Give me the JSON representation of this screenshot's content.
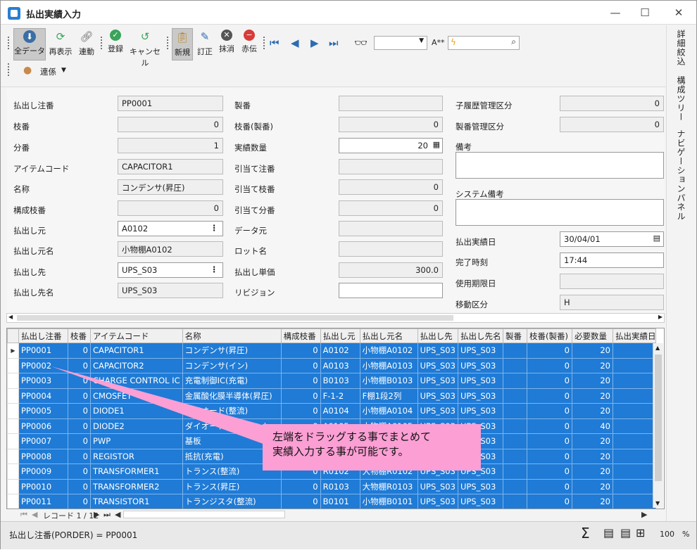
{
  "window": {
    "title": "払出実績入力",
    "minimize": "—",
    "maximize": "☐",
    "close": "✕"
  },
  "toolbar": {
    "buttons": [
      {
        "id": "all-data",
        "label": "全データ",
        "icon": "download-icon"
      },
      {
        "id": "refresh",
        "label": "再表示",
        "icon": "refresh-icon"
      },
      {
        "id": "link",
        "label": "連動",
        "icon": "link-icon"
      },
      {
        "id": "register",
        "label": "登録",
        "icon": "check-icon"
      },
      {
        "id": "cancel",
        "label": "キャンセル",
        "icon": "undo-icon"
      },
      {
        "id": "new",
        "label": "新規",
        "icon": "clipboard-icon"
      },
      {
        "id": "correct",
        "label": "訂正",
        "icon": "pencil-icon"
      },
      {
        "id": "erase",
        "label": "抹消",
        "icon": "x-circle-icon"
      },
      {
        "id": "reverse",
        "label": "赤伝",
        "icon": "minus-circle-icon"
      }
    ],
    "font_label": "A**",
    "relation_label": "連係"
  },
  "right_panel": {
    "items": [
      "詳細絞込",
      "構成ツリー",
      "ナビゲーションパネル"
    ]
  },
  "form": {
    "col1": [
      {
        "label": "払出し注番",
        "value": "PP0001",
        "white": false
      },
      {
        "label": "枝番",
        "value": "0",
        "num": true
      },
      {
        "label": "分番",
        "value": "1",
        "num": true
      },
      {
        "label": "アイテムコード",
        "value": "CAPACITOR1"
      },
      {
        "label": "名称",
        "value": "コンデンサ(昇圧)"
      },
      {
        "label": "構成枝番",
        "value": "0",
        "num": true
      },
      {
        "label": "払出し元",
        "value": "A0102",
        "white": true,
        "dots": true
      },
      {
        "label": "払出し元名",
        "value": "小物棚A0102"
      },
      {
        "label": "払出し先",
        "value": "UPS_S03",
        "white": true,
        "dots": true
      },
      {
        "label": "払出し先名",
        "value": "UPS_S03"
      }
    ],
    "col2": [
      {
        "label": "製番",
        "value": ""
      },
      {
        "label": "枝番(製番)",
        "value": "0",
        "num": true
      },
      {
        "label": "実績数量",
        "value": "20",
        "num": true,
        "white": true
      },
      {
        "label": "引当て注番",
        "value": ""
      },
      {
        "label": "引当て枝番",
        "value": "0",
        "num": true
      },
      {
        "label": "引当て分番",
        "value": "0",
        "num": true
      },
      {
        "label": "データ元",
        "value": ""
      },
      {
        "label": "ロット名",
        "value": ""
      },
      {
        "label": "払出し単価",
        "value": "300.0",
        "num": true
      },
      {
        "label": "リビジョン",
        "value": "",
        "white": true
      }
    ],
    "col3": {
      "child_history": {
        "label": "子履歴管理区分",
        "value": "0"
      },
      "serial_mgmt": {
        "label": "製番管理区分",
        "value": "0"
      },
      "remarks": {
        "label": "備考",
        "value": ""
      },
      "system_remarks": {
        "label": "システム備考",
        "value": ""
      },
      "issue_date": {
        "label": "払出実績日",
        "value": "30/04/01"
      },
      "complete_time": {
        "label": "完了時刻",
        "value": "17:44"
      },
      "expiry": {
        "label": "使用期限日",
        "value": ""
      },
      "move_class": {
        "label": "移動区分",
        "value": "H"
      }
    }
  },
  "grid": {
    "columns": [
      "払出し注番",
      "枝番",
      "アイテムコード",
      "名称",
      "構成枝番",
      "払出し元",
      "払出し元名",
      "払出し先",
      "払出し先名",
      "製番",
      "枝番(製番)",
      "必要数量",
      "払出実績日"
    ],
    "rows": [
      [
        "PP0001",
        "0",
        "CAPACITOR1",
        "コンデンサ(昇圧)",
        "0",
        "A0102",
        "小物棚A0102",
        "UPS_S03",
        "UPS_S03",
        "",
        "0",
        "20",
        ""
      ],
      [
        "PP0002",
        "0",
        "CAPACITOR2",
        "コンデンサ(イン)",
        "0",
        "A0103",
        "小物棚A0103",
        "UPS_S03",
        "UPS_S03",
        "",
        "0",
        "20",
        ""
      ],
      [
        "PP0003",
        "0",
        "CHARGE CONTROL IC",
        "充電制御IC(充電)",
        "0",
        "B0103",
        "小物棚B0103",
        "UPS_S03",
        "UPS_S03",
        "",
        "0",
        "20",
        ""
      ],
      [
        "PP0004",
        "0",
        "CMOSFET",
        "金属酸化膜半導体(昇圧)",
        "0",
        "F-1-2",
        "F棚1段2列",
        "UPS_S03",
        "UPS_S03",
        "",
        "0",
        "20",
        ""
      ],
      [
        "PP0005",
        "0",
        "DIODE1",
        "ダイオード(整流)",
        "0",
        "A0104",
        "小物棚A0104",
        "UPS_S03",
        "UPS_S03",
        "",
        "0",
        "20",
        ""
      ],
      [
        "PP0006",
        "0",
        "DIODE2",
        "ダイオード(充電/イン)",
        "0",
        "A0105",
        "小物棚A0105",
        "UPS_S03",
        "UPS_S03",
        "",
        "0",
        "40",
        ""
      ],
      [
        "PP0007",
        "0",
        "PWP",
        "基板",
        "0",
        "",
        "",
        "UPS_S03",
        "UPS_S03",
        "",
        "0",
        "20",
        ""
      ],
      [
        "PP0008",
        "0",
        "REGISTOR",
        "抵抗(充電)",
        "0",
        "",
        "",
        "UPS_S03",
        "UPS_S03",
        "",
        "0",
        "20",
        ""
      ],
      [
        "PP0009",
        "0",
        "TRANSFORMER1",
        "トランス(整流)",
        "0",
        "R0102",
        "大物棚R0102",
        "UPS_S03",
        "UPS_S03",
        "",
        "0",
        "20",
        ""
      ],
      [
        "PP0010",
        "0",
        "TRANSFORMER2",
        "トランス(昇圧)",
        "0",
        "R0103",
        "大物棚R0103",
        "UPS_S03",
        "UPS_S03",
        "",
        "0",
        "20",
        ""
      ],
      [
        "PP0011",
        "0",
        "TRANSISTOR1",
        "トランジスタ(整流)",
        "0",
        "B0101",
        "小物棚B0101",
        "UPS_S03",
        "UPS_S03",
        "",
        "0",
        "20",
        ""
      ]
    ]
  },
  "pager": {
    "text": "レコード 1 / 12"
  },
  "status": {
    "text": "払出し注番(PORDER) = PP0001",
    "zoom": "100",
    "percent": "%"
  },
  "callout": {
    "line1": "左端をドラッグする事でまとめて",
    "line2": "実績入力する事が可能です。"
  },
  "colors": {
    "selection": "#1f7bd6",
    "callout": "#fb9fd4"
  }
}
